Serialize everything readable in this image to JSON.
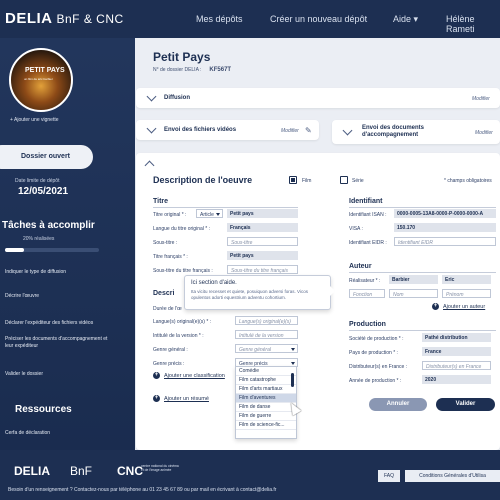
{
  "header": {
    "brand": "DELIA",
    "partners": "BnF & CNC",
    "nav": [
      "Mes dépôts",
      "Créer un nouveau dépôt",
      "Aide",
      "Hélène Rameti"
    ]
  },
  "sidebar": {
    "thumb_title": "PETIT PAYS",
    "thumb_sub": "un film de éric barbier",
    "add_thumb": "+ Ajouter une vignette",
    "status": "Dossier ouvert",
    "deadline_label": "Date limite de dépôt",
    "deadline": "12/05/2021",
    "tasks_title": "Tâches à accomplir",
    "progress_text": "20% réalisées",
    "progress": 0.2,
    "tasks": [
      "Indiquer le type de diffusion",
      "Décrire l'œuvre",
      "Déclarer l'expéditeur des fichiers vidéos",
      "Préciser les documents d'accompagnement et leur expéditeur",
      "Valider le dossier"
    ],
    "resources_title": "Ressources",
    "resources": [
      "Cerfa de déclaration"
    ]
  },
  "main": {
    "title": "Petit Pays",
    "dossier_label": "N° de dossier DELIA :",
    "dossier_num": "KF567T",
    "diffusion": "Diffusion",
    "modifier": "Modifier",
    "videos": "Envoi des fichiers vidéos",
    "docs": "Envoi des documents d'accompagnement",
    "desc_title": "Description de l'oeuvre",
    "film": "Film",
    "serie": "Série",
    "required": "* champs obligatoires",
    "titre": {
      "h": "Titre",
      "orig_label": "Titre original * :",
      "article": "Article",
      "orig": "Petit pays",
      "lang_label": "Langue du titre original * :",
      "lang": "Français",
      "sous_label": "Sous-titre :",
      "sous_ph": "Sous-titre",
      "fr_label": "Titre français * :",
      "fr": "Petit pays",
      "sousfr_label": "Sous-titre du titre français :",
      "sousfr_ph": "Sous-titre du titre français"
    },
    "desc": {
      "h": "Descri",
      "duree": "Durée de l'œ",
      "langues_label": "Langue(s) original(e)(s) * :",
      "langues_ph": "Langue(s) original(e)(s)",
      "version_label": "Intitulé de la version * :",
      "version_ph": "Intitulé de la version",
      "genre_label": "Genre général :",
      "genre_ph": "Genre général",
      "precis_label": "Genre précis :",
      "precis_ph": "Genre précis",
      "add_class": "Ajouter une classification",
      "add_resume": "Ajouter un résumé"
    },
    "genres": [
      "Comédie",
      "Film catastrophe",
      "Film d'arts martiaux",
      "Film d'aventures",
      "Film de danse",
      "Film de guerre",
      "Film de science-fic..."
    ],
    "tooltip": {
      "title": "Ici section d'aide.",
      "body": "Ita vicitu recesset et quiete, posuiquon adversi foras. Vicos opulentos adorti equestrium adventu cohortium."
    },
    "ident": {
      "h": "Identifiant",
      "isan_label": "Identifiant ISAN :",
      "isan": "0000-0005-13A8-0000-P-0000-0000-A",
      "visa_label": "VISA :",
      "visa": "150.170",
      "eidr_label": "Identifiant EIDR :",
      "eidr_ph": "Identifiant EIDR"
    },
    "auteur": {
      "h": "Auteur",
      "real_label": "Réalisateur * :",
      "nom": "Barbier",
      "prenom": "Eric",
      "fonction_ph": "Fonction",
      "nom_ph": "Nom",
      "prenom_ph": "Prénom",
      "add": "Ajouter un auteur"
    },
    "prod": {
      "h": "Production",
      "soc_label": "Société de production * :",
      "soc": "Pathé distribution",
      "pays_label": "Pays de production * :",
      "pays": "France",
      "dist_label": "Distributeur(s) en France :",
      "dist_ph": "Distributeur(s) en France",
      "annee_label": "Année de production * :",
      "annee": "2020"
    },
    "cancel": "Annuler",
    "validate": "Valider"
  },
  "footer": {
    "brand": "DELIA",
    "bnf": "BnF",
    "cnc": "CNC",
    "cnc_sub": "centre national du cinéma et de l'image animée",
    "faq": "FAQ",
    "cgu": "Conditions Générales d'Utilisa",
    "help": "Besoin d'un renseignement ? Contactez-nous par téléphone au 01 23 45 67 89 ou par mail en écrivant à contact@delia.fr"
  },
  "colors": {
    "navy": "#1d2f52",
    "panel": "#ebeef4",
    "cancel": "#8a97b3"
  }
}
